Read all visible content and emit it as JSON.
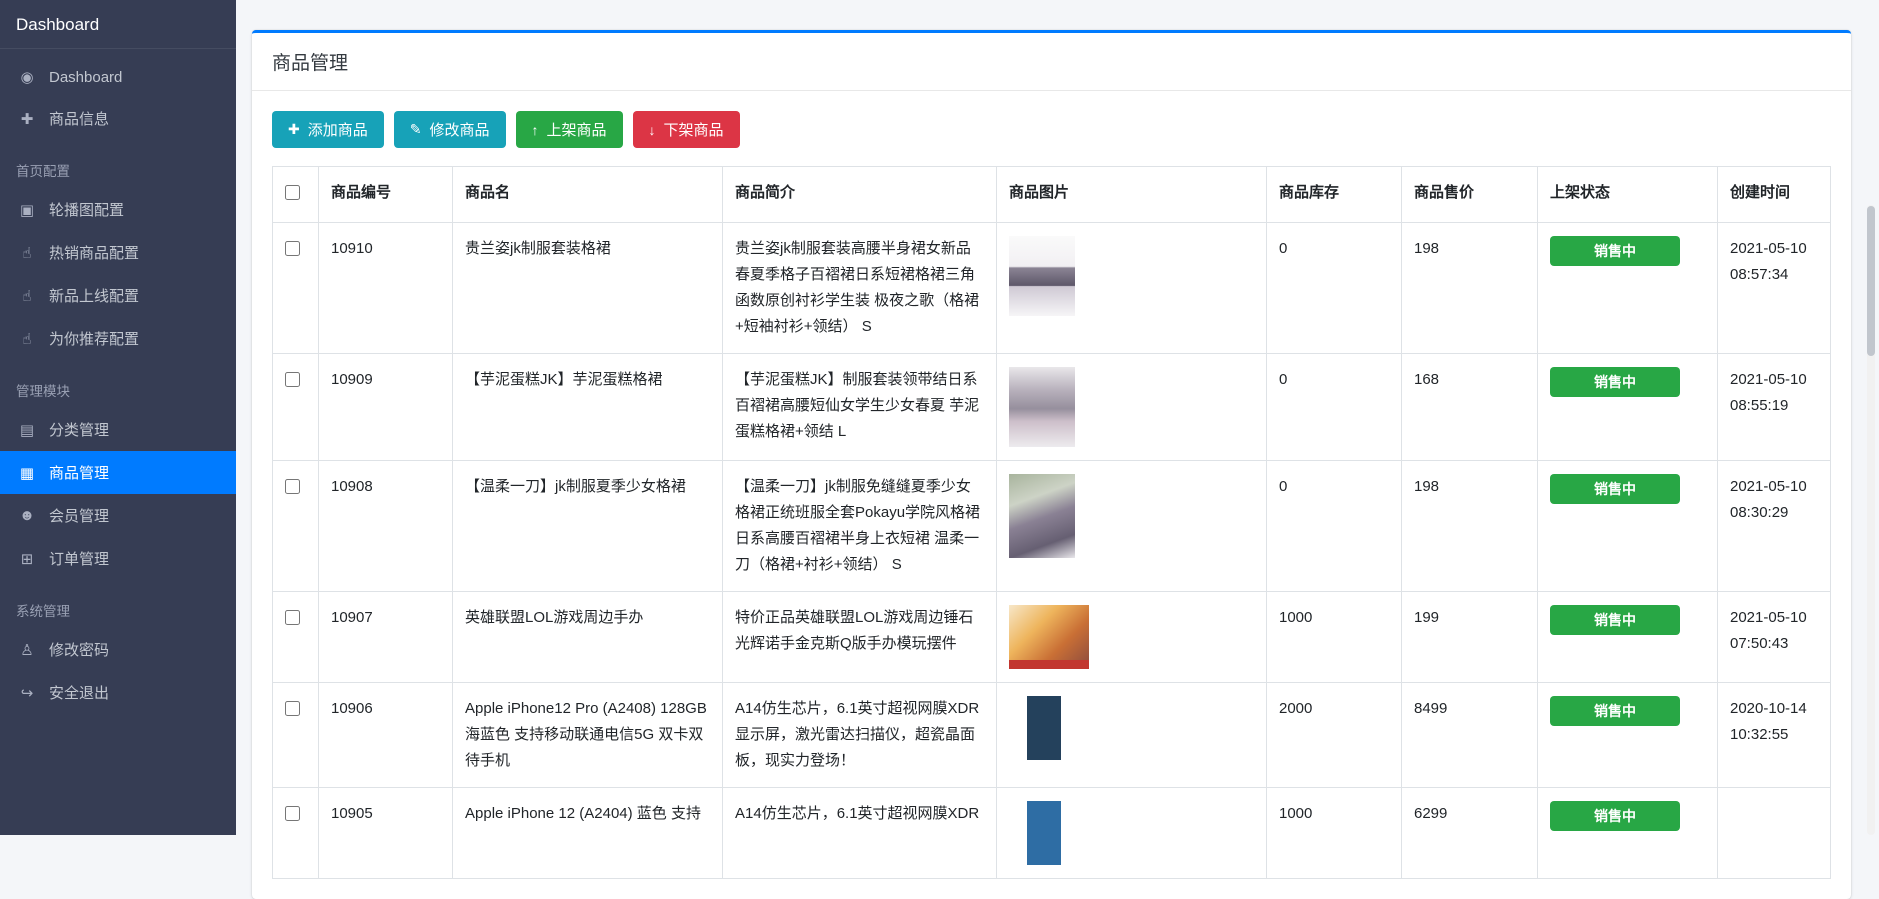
{
  "colors": {
    "accent": "#007bff",
    "sidebar_bg": "#363d54",
    "page_bg": "#f4f6f9",
    "info_button": "#17a2b8",
    "success_button": "#28a745",
    "danger_button": "#dc3545",
    "status_badge": "#28a745"
  },
  "sidebar": {
    "brand": "Dashboard",
    "groups": [
      {
        "header": "",
        "items": [
          {
            "label": "Dashboard",
            "icon": "dashboard",
            "active": false
          },
          {
            "label": "商品信息",
            "icon": "plus",
            "active": false
          }
        ]
      },
      {
        "header": "首页配置",
        "items": [
          {
            "label": "轮播图配置",
            "icon": "image",
            "active": false
          },
          {
            "label": "热销商品配置",
            "icon": "thumbs-up",
            "active": false
          },
          {
            "label": "新品上线配置",
            "icon": "thumbs-up",
            "active": false
          },
          {
            "label": "为你推荐配置",
            "icon": "thumbs-up",
            "active": false
          }
        ]
      },
      {
        "header": "管理模块",
        "items": [
          {
            "label": "分类管理",
            "icon": "list",
            "active": false
          },
          {
            "label": "商品管理",
            "icon": "grid",
            "active": true
          },
          {
            "label": "会员管理",
            "icon": "users",
            "active": false
          },
          {
            "label": "订单管理",
            "icon": "order-card",
            "active": false
          }
        ]
      },
      {
        "header": "系统管理",
        "items": [
          {
            "label": "修改密码",
            "icon": "password-user",
            "active": false
          },
          {
            "label": "安全退出",
            "icon": "logout",
            "active": false
          }
        ]
      }
    ]
  },
  "page": {
    "title": "商品管理"
  },
  "toolbar": {
    "buttons": [
      {
        "label": "添加商品",
        "icon": "plus",
        "color": "#17a2b8",
        "name": "add-product-button"
      },
      {
        "label": "修改商品",
        "icon": "edit",
        "color": "#17a2b8",
        "name": "edit-product-button"
      },
      {
        "label": "上架商品",
        "icon": "arrow-up",
        "color": "#28a745",
        "name": "list-product-button"
      },
      {
        "label": "下架商品",
        "icon": "arrow-down",
        "color": "#dc3545",
        "name": "delist-product-button"
      }
    ]
  },
  "table": {
    "columns": [
      "商品编号",
      "商品名",
      "商品简介",
      "商品图片",
      "商品库存",
      "商品售价",
      "上架状态",
      "创建时间"
    ],
    "rows": [
      {
        "id": "10910",
        "name": "贵兰姿jk制服套装格裙",
        "desc": "贵兰姿jk制服套装高腰半身裙女新品春夏季格子百褶裙日系短裙格裙三角函数原创衬衫学生装 极夜之歌（格裙+短袖衬衫+领结） S",
        "image": "jk-outfit-1",
        "stock": "0",
        "price": "198",
        "status": "销售中",
        "created": "2021-05-10 08:57:34"
      },
      {
        "id": "10909",
        "name": "【芋泥蛋糕JK】芋泥蛋糕格裙",
        "desc": "【芋泥蛋糕JK】制服套装领带结日系百褶裙高腰短仙女学生少女春夏 芋泥蛋糕格裙+领结 L",
        "image": "jk-outfit-2",
        "stock": "0",
        "price": "168",
        "status": "销售中",
        "created": "2021-05-10 08:55:19"
      },
      {
        "id": "10908",
        "name": "【温柔一刀】jk制服夏季少女格裙",
        "desc": "【温柔一刀】jk制服免缝缝夏季少女格裙正统班服全套Pokayu学院风格裙日系高腰百褶裙半身上衣短裙 温柔一刀（格裙+衬衫+领结） S",
        "image": "jk-outfit-3",
        "stock": "0",
        "price": "198",
        "status": "销售中",
        "created": "2021-05-10 08:30:29"
      },
      {
        "id": "10907",
        "name": "英雄联盟LOL游戏周边手办",
        "desc": "特价正品英雄联盟LOL游戏周边锤石光辉诺手金克斯Q版手办模玩摆件",
        "image": "lol-figures",
        "stock": "1000",
        "price": "199",
        "status": "销售中",
        "created": "2021-05-10 07:50:43"
      },
      {
        "id": "10906",
        "name": "Apple iPhone12 Pro (A2408) 128GB 海蓝色 支持移动联通电信5G 双卡双待手机",
        "desc": "A14仿生芯片，6.1英寸超视网膜XDR显示屏，激光雷达扫描仪，超瓷晶面板，现实力登场！",
        "image": "iphone-12-pro-blue",
        "stock": "2000",
        "price": "8499",
        "status": "销售中",
        "created": "2020-10-14 10:32:55"
      },
      {
        "id": "10905",
        "name": "Apple iPhone 12 (A2404) 蓝色 支持",
        "desc": "A14仿生芯片，6.1英寸超视网膜XDR",
        "image": "iphone-12-blue",
        "stock": "1000",
        "price": "6299",
        "status": "销售中",
        "created": ""
      }
    ]
  }
}
